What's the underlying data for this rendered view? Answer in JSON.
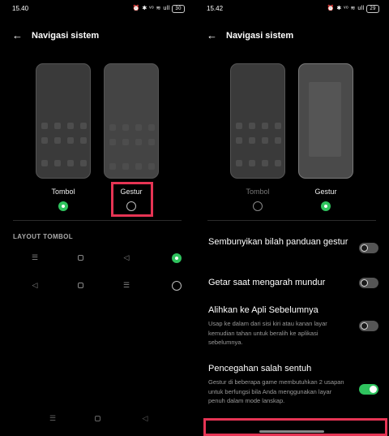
{
  "left": {
    "status": {
      "time": "15.40",
      "icons": "⏰ ✱ ᵛᵒ ≋ ull",
      "battery": "30"
    },
    "header": {
      "title": "Navigasi sistem"
    },
    "options": [
      {
        "label": "Tombol",
        "selected": true
      },
      {
        "label": "Gestur",
        "selected": false
      }
    ],
    "layout": {
      "heading": "LAYOUT TOMBOL",
      "rows": [
        {
          "icons": [
            "menu-icon",
            "home-square-icon",
            "back-triangle-icon"
          ],
          "selected": true
        },
        {
          "icons": [
            "back-triangle-icon",
            "home-square-icon",
            "menu-icon"
          ],
          "selected": false
        }
      ]
    },
    "highlight_color": "#e63454"
  },
  "right": {
    "status": {
      "time": "15.42",
      "icons": "⏰ ✱ ᵛᵒ ≋ ull",
      "battery": "29"
    },
    "header": {
      "title": "Navigasi sistem"
    },
    "options": [
      {
        "label": "Tombol",
        "selected": false
      },
      {
        "label": "Gestur",
        "selected": true
      }
    ],
    "settings": [
      {
        "label": "Sembunyikan bilah panduan gestur",
        "desc": "",
        "on": false
      },
      {
        "label": "Getar saat mengarah mundur",
        "desc": "",
        "on": false
      },
      {
        "label": "Alihkan ke Apli Sebelumnya",
        "desc": "Usap ke dalam dari sisi kiri atau kanan layar kemudian tahan untuk beralih ke aplikasi sebelumnya.",
        "on": false
      },
      {
        "label": "Pencegahan salah sentuh",
        "desc": "Gestur di beberapa game membutuhkan 2 usapan untuk berfungsi bila Anda menggunakan layar penuh dalam mode lanskap.",
        "on": true
      }
    ]
  },
  "colors": {
    "accent_green": "#2fc35e",
    "highlight_red": "#e63454"
  }
}
